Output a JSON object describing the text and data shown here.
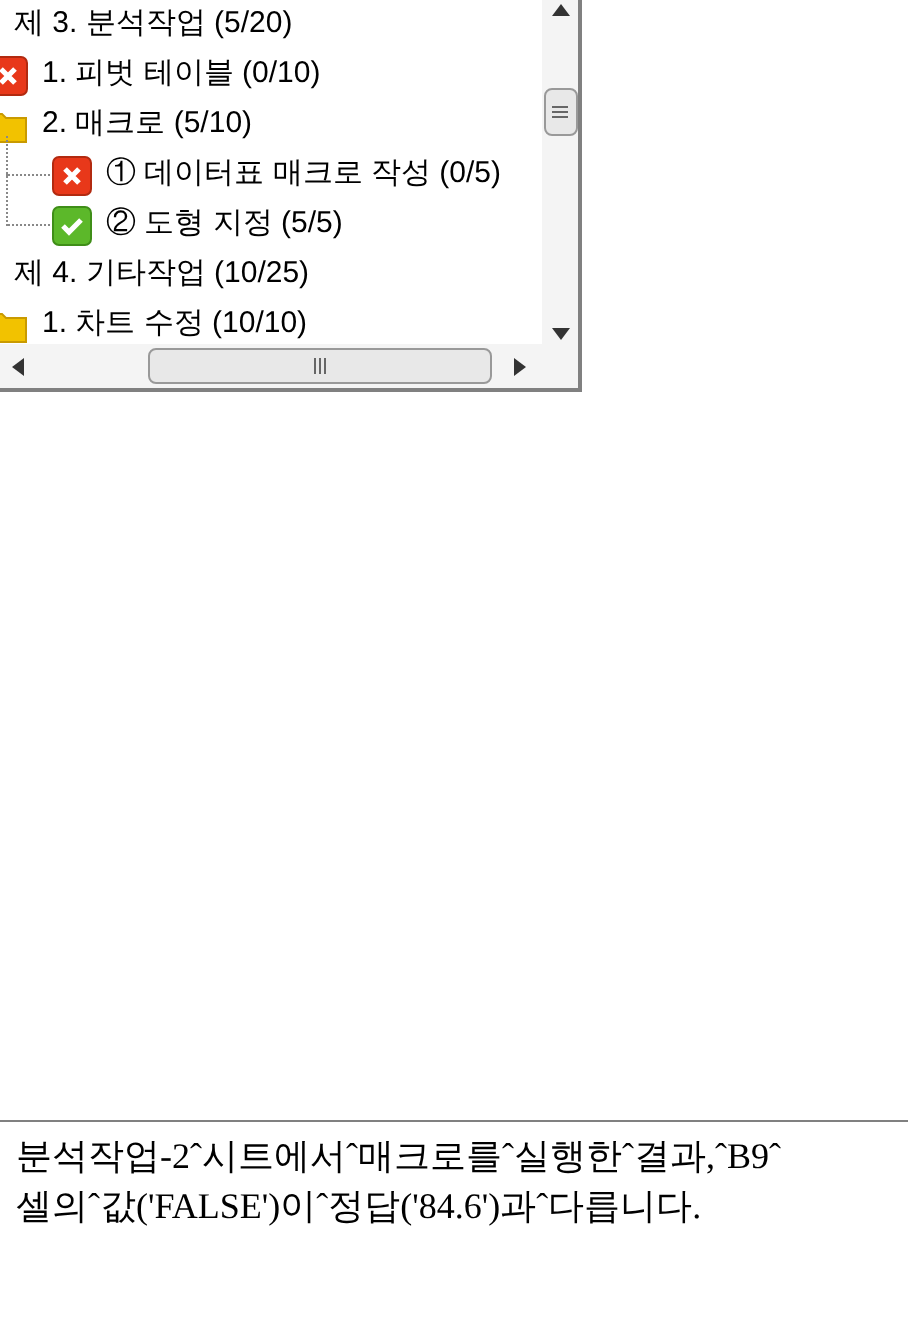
{
  "tree": [
    {
      "label": "제 3. 분석작업 (5/20)",
      "children": [
        {
          "label": "1. 피벗 테이블 (0/10)",
          "kind": "fail"
        },
        {
          "label": "2. 매크로 (5/10)",
          "kind": "folder",
          "children": [
            {
              "label": "① 데이터표 매크로 작성 (0/5)",
              "kind": "fail"
            },
            {
              "label": "② 도형 지정 (5/5)",
              "kind": "pass"
            }
          ]
        }
      ]
    },
    {
      "label": "제 4. 기타작업 (10/25)",
      "children": [
        {
          "label": "1. 차트 수정 (10/10)",
          "kind": "folder"
        }
      ]
    }
  ],
  "message": "분석작업-2ˆ시트에서ˆ매크로를ˆ실행한ˆ결과,ˆB9ˆ 셀의ˆ값('FALSE')이ˆ정답('84.6')과ˆ다릅니다."
}
